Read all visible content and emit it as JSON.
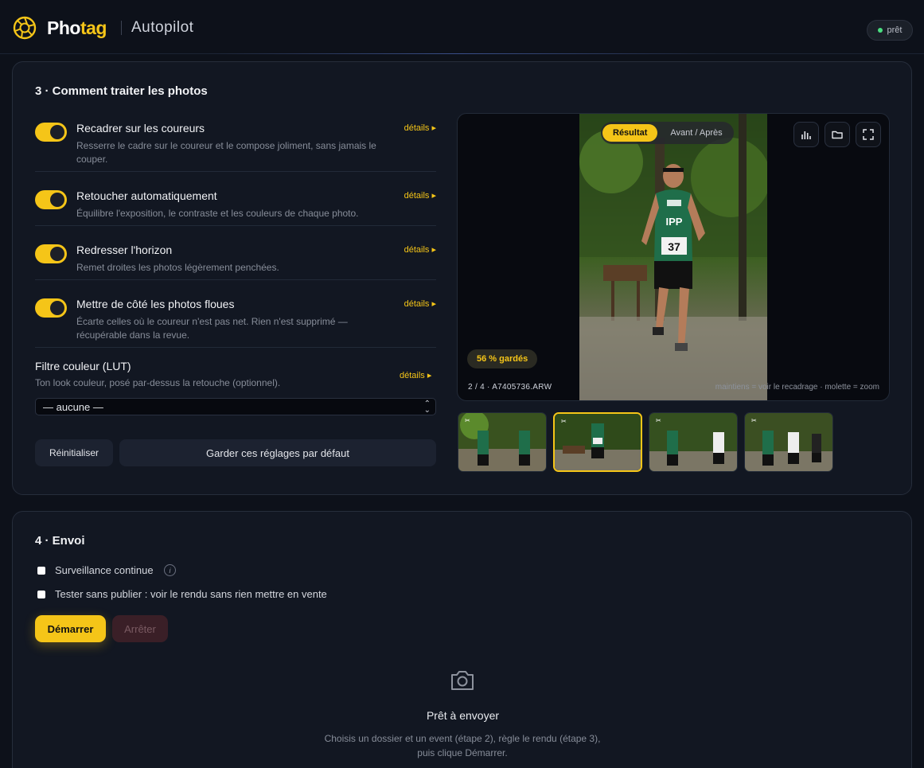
{
  "header": {
    "brand_pre": "Pho",
    "brand_post": "tag",
    "subtitle": "Autopilot",
    "status": "prêt",
    "status_color": "#4ade80",
    "accent": "#f5c518"
  },
  "processing": {
    "title": "3 · Comment traiter les photos",
    "options": [
      {
        "label": "Recadrer sur les coureurs",
        "desc": "Resserre le cadre sur le coureur et le compose joliment, sans jamais le couper.",
        "details": "détails ▸",
        "enabled": true
      },
      {
        "label": "Retoucher automatiquement",
        "desc": "Équilibre l'exposition, le contraste et les couleurs de chaque photo.",
        "details": "détails ▸",
        "enabled": true
      },
      {
        "label": "Redresser l'horizon",
        "desc": "Remet droites les photos légèrement penchées.",
        "details": "détails ▸",
        "enabled": true
      },
      {
        "label": "Mettre de côté les photos floues",
        "desc": "Écarte celles où le coureur n'est pas net. Rien n'est supprimé — récupérable dans la revue.",
        "details": "détails ▸",
        "enabled": true
      }
    ],
    "lut": {
      "title": "Filtre couleur (LUT)",
      "desc": "Ton look couleur, posé par-dessus la retouche (optionnel).",
      "details": "détails ▸",
      "selected": "— aucune —"
    },
    "reset_label": "Réinitialiser",
    "keep_label": "Garder ces réglages par défaut"
  },
  "viewer": {
    "tab_result": "Résultat",
    "tab_compare": "Avant / Après",
    "kept_badge": "56 % gardés",
    "filename": "2 / 4 · A7405736.ARW",
    "hint": "maintiens = voir le recadrage · molette = zoom",
    "bib_number": "37",
    "jersey_text": "IPP",
    "selected_thumb": 2,
    "thumb_count": 4
  },
  "send": {
    "title": "4 · Envoi",
    "watch_label": "Surveillance continue",
    "info_icon": "i",
    "test_label": "Tester sans publier : voir le rendu sans rien mettre en vente",
    "start_label": "Démarrer",
    "stop_label": "Arrêter",
    "empty_title": "Prêt à envoyer",
    "empty_desc": "Choisis un dossier et un event (étape 2), règle le rendu (étape 3), puis clique Démarrer."
  }
}
